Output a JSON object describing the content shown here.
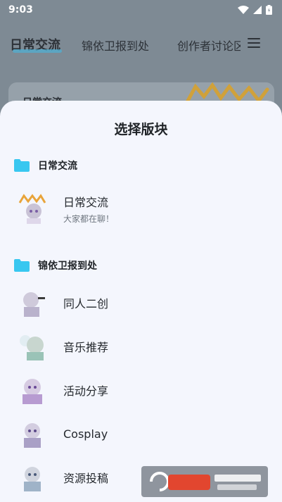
{
  "status": {
    "time": "9:03"
  },
  "tabs": [
    {
      "label": "日常交流"
    },
    {
      "label": "锦依卫报到处"
    },
    {
      "label": "创作者讨论区"
    }
  ],
  "background_card": {
    "title": "日常交流"
  },
  "sheet": {
    "title": "选择版块",
    "groups": [
      {
        "label": "日常交流",
        "items": [
          {
            "name": "日常交流",
            "desc": "大家都在聊！"
          }
        ]
      },
      {
        "label": "锦依卫报到处",
        "items": [
          {
            "name": "同人二创"
          },
          {
            "name": "音乐推荐"
          },
          {
            "name": "活动分享"
          },
          {
            "name": "Cosplay"
          },
          {
            "name": "资源投稿"
          }
        ]
      }
    ]
  },
  "colors": {
    "folder": "#38c7f0",
    "sheet_bg": "#f4f6fd",
    "scrim": "#7e8a94"
  }
}
